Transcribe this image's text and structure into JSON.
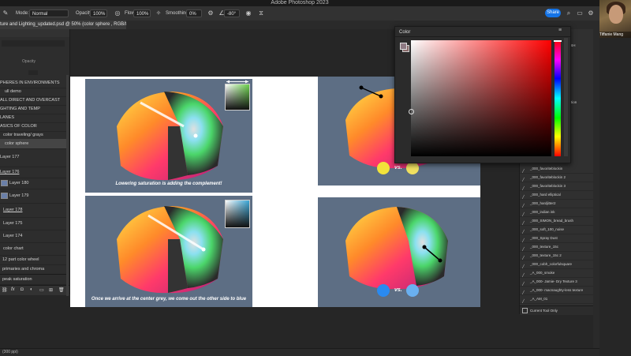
{
  "window": {
    "title": "Adobe Photoshop 2023"
  },
  "options_bar": {
    "mode_label": "Mode:",
    "mode_value": "Normal",
    "opacity_label": "Opacity:",
    "opacity_value": "100%",
    "flow_label": "Flow:",
    "flow_value": "100%",
    "smoothing_label": "Smoothing:",
    "smoothing_value": "0%",
    "angle_value": "-80°",
    "share_label": "Share"
  },
  "document_tab": {
    "label": "ture and Lighting_updated.psd @ 50% (color sphere , RGB/8*) *"
  },
  "layers_panel": {
    "header_text": "Opacity",
    "items": [
      {
        "label": "PHERES IN ENVIRONMENTS"
      },
      {
        "label": "ull demo"
      },
      {
        "label": "ALL DIRECT AND OVERCAST"
      },
      {
        "label": "GHTING AND TEMP"
      },
      {
        "label": "LANES"
      },
      {
        "label": "ASICS OF COLOR"
      },
      {
        "label": "color traveling/ grays"
      },
      {
        "label": "color sphere"
      },
      {
        "label": "Layer 177"
      },
      {
        "label": "Layer 176"
      },
      {
        "label": "Layer 180"
      },
      {
        "label": "Layer 179"
      },
      {
        "label": "Layer 178"
      },
      {
        "label": "Layer 175"
      },
      {
        "label": "Layer 174"
      },
      {
        "label": "color chart"
      },
      {
        "label": "12 part color wheel"
      },
      {
        "label": "primaries and chroma"
      },
      {
        "label": "peak saturation"
      }
    ]
  },
  "canvas": {
    "caption_top": "Lowering saturation is adding the complement!",
    "caption_bottom": "Once we arrive at the center grey, we come out the other side to blue",
    "vs_top": "vs.",
    "vs_bottom": "vs."
  },
  "color_panel": {
    "title": "Color",
    "foreground_color": "#ff0000"
  },
  "right_panel_upper": {
    "labels": [
      "USH",
      "ration",
      "nt"
    ]
  },
  "brushes_panel": {
    "items": [
      {
        "label": "_000_favoriteblockin"
      },
      {
        "label": "_000_favoriteblockin 2"
      },
      {
        "label": "_000_favoriteblockin 3"
      },
      {
        "label": "_000_hard elliptical"
      },
      {
        "label": "_000_hardjitter2"
      },
      {
        "label": "_000_indian ink"
      },
      {
        "label": "_000_SIMON_bread_brush"
      },
      {
        "label": "_000_soft_100_noise"
      },
      {
        "label": "_000_Spray Dust"
      },
      {
        "label": "_000_texture_15c"
      },
      {
        "label": "_000_texture_15c 2"
      },
      {
        "label": "_000_cobh_colorfulsquare"
      },
      {
        "label": "_A_000_smoke"
      },
      {
        "label": "_A_000- Jamie- Dry Texture 3"
      },
      {
        "label": "_A_000- macnaughty-less texture"
      },
      {
        "label": "_A_AM_01"
      },
      {
        "label": "_A_AM_03"
      }
    ],
    "footer_label": "Current Tool Only"
  },
  "webcam": {
    "name": "Tiffanie Mang"
  },
  "status_bar": {
    "text": "(300 ppi)"
  }
}
